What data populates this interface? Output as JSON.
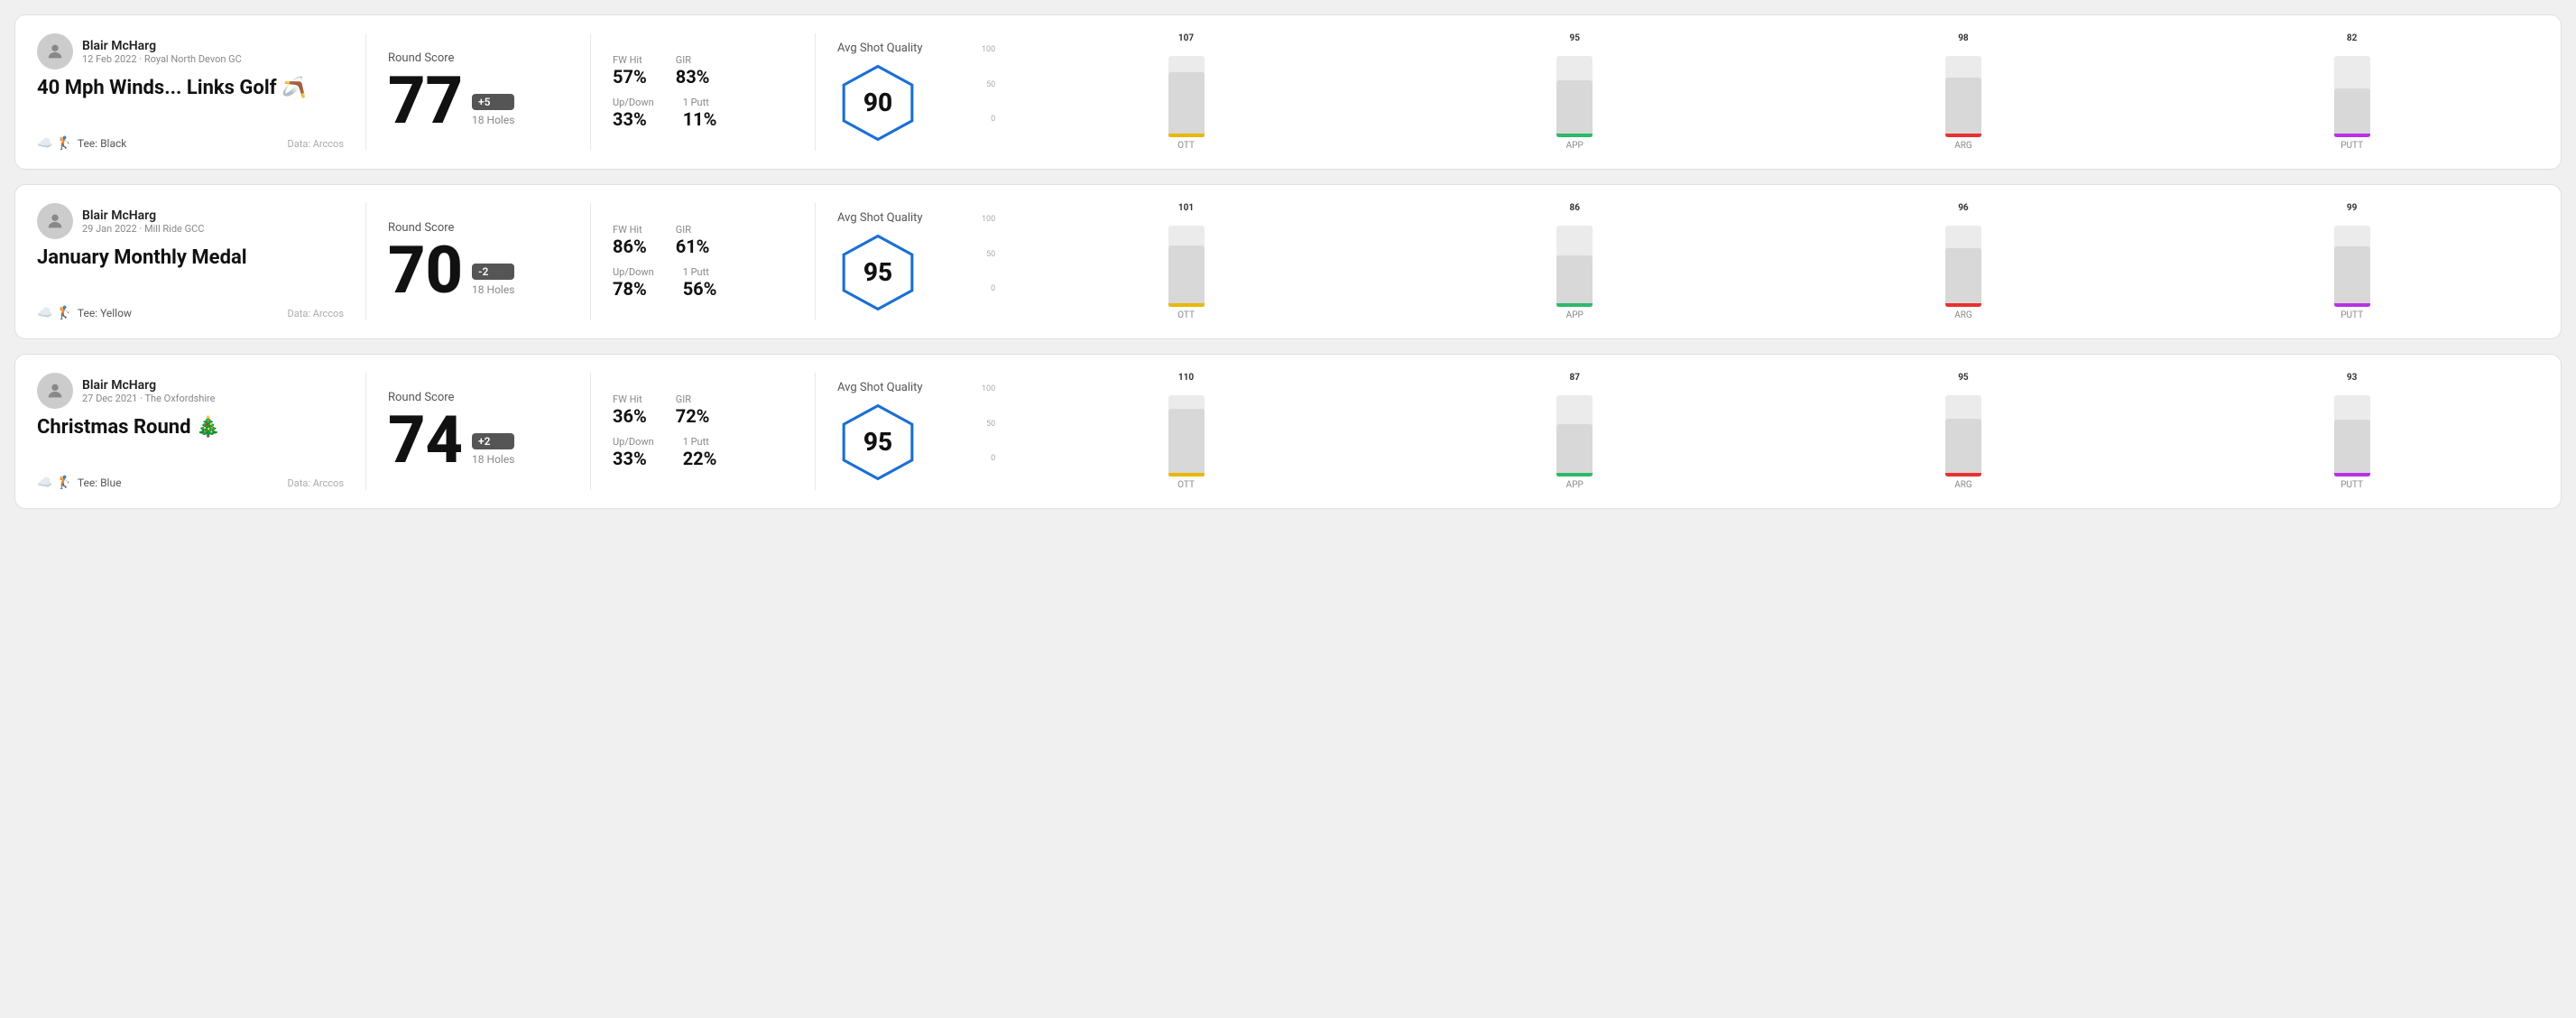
{
  "rounds": [
    {
      "id": "round1",
      "user": "Blair McHarg",
      "date": "12 Feb 2022 · Royal North Devon GC",
      "title": "40 Mph Winds... Links Golf 🪃",
      "tee": "Black",
      "dataSource": "Data: Arccos",
      "roundScore": "Round Score",
      "score": "77",
      "scoreDiff": "+5",
      "diffSign": "positive",
      "holes": "18 Holes",
      "fwHit": "57%",
      "gir": "83%",
      "upDown": "33%",
      "onePutt": "11%",
      "avgShotQuality": "Avg Shot Quality",
      "qualityScore": "90",
      "chartBars": [
        {
          "label": "OTT",
          "value": 107,
          "color": "#e8b800",
          "heightPct": 80
        },
        {
          "label": "APP",
          "value": 95,
          "color": "#2db86b",
          "heightPct": 70
        },
        {
          "label": "ARG",
          "value": 98,
          "color": "#e83030",
          "heightPct": 73
        },
        {
          "label": "PUTT",
          "value": 82,
          "color": "#b830e8",
          "heightPct": 60
        }
      ]
    },
    {
      "id": "round2",
      "user": "Blair McHarg",
      "date": "29 Jan 2022 · Mill Ride GCC",
      "title": "January Monthly Medal",
      "tee": "Yellow",
      "dataSource": "Data: Arccos",
      "roundScore": "Round Score",
      "score": "70",
      "scoreDiff": "-2",
      "diffSign": "negative",
      "holes": "18 Holes",
      "fwHit": "86%",
      "gir": "61%",
      "upDown": "78%",
      "onePutt": "56%",
      "avgShotQuality": "Avg Shot Quality",
      "qualityScore": "95",
      "chartBars": [
        {
          "label": "OTT",
          "value": 101,
          "color": "#e8b800",
          "heightPct": 76
        },
        {
          "label": "APP",
          "value": 86,
          "color": "#2db86b",
          "heightPct": 63
        },
        {
          "label": "ARG",
          "value": 96,
          "color": "#e83030",
          "heightPct": 72
        },
        {
          "label": "PUTT",
          "value": 99,
          "color": "#b830e8",
          "heightPct": 74
        }
      ]
    },
    {
      "id": "round3",
      "user": "Blair McHarg",
      "date": "27 Dec 2021 · The Oxfordshire",
      "title": "Christmas Round 🎄",
      "tee": "Blue",
      "dataSource": "Data: Arccos",
      "roundScore": "Round Score",
      "score": "74",
      "scoreDiff": "+2",
      "diffSign": "positive",
      "holes": "18 Holes",
      "fwHit": "36%",
      "gir": "72%",
      "upDown": "33%",
      "onePutt": "22%",
      "avgShotQuality": "Avg Shot Quality",
      "qualityScore": "95",
      "chartBars": [
        {
          "label": "OTT",
          "value": 110,
          "color": "#e8b800",
          "heightPct": 83
        },
        {
          "label": "APP",
          "value": 87,
          "color": "#2db86b",
          "heightPct": 64
        },
        {
          "label": "ARG",
          "value": 95,
          "color": "#e83030",
          "heightPct": 71
        },
        {
          "label": "PUTT",
          "value": 93,
          "color": "#b830e8",
          "heightPct": 70
        }
      ]
    }
  ],
  "yAxisLabels": [
    "100",
    "50",
    "0"
  ]
}
